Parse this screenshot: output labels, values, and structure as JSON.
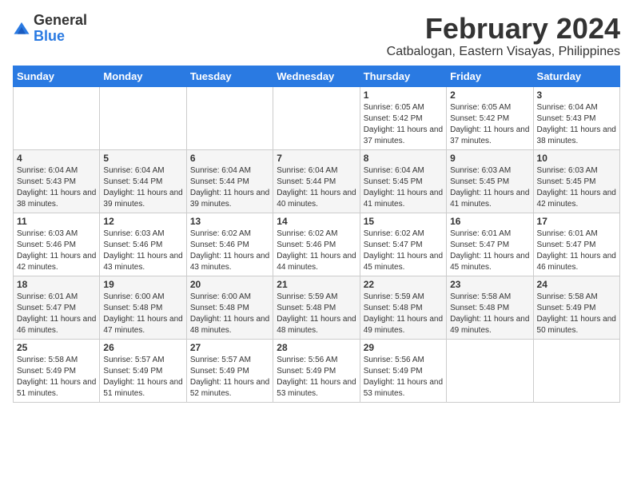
{
  "header": {
    "logo_general": "General",
    "logo_blue": "Blue",
    "main_title": "February 2024",
    "subtitle": "Catbalogan, Eastern Visayas, Philippines"
  },
  "calendar": {
    "days_of_week": [
      "Sunday",
      "Monday",
      "Tuesday",
      "Wednesday",
      "Thursday",
      "Friday",
      "Saturday"
    ],
    "weeks": [
      [
        {
          "day": "",
          "info": ""
        },
        {
          "day": "",
          "info": ""
        },
        {
          "day": "",
          "info": ""
        },
        {
          "day": "",
          "info": ""
        },
        {
          "day": "1",
          "info": "Sunrise: 6:05 AM\nSunset: 5:42 PM\nDaylight: 11 hours and 37 minutes."
        },
        {
          "day": "2",
          "info": "Sunrise: 6:05 AM\nSunset: 5:42 PM\nDaylight: 11 hours and 37 minutes."
        },
        {
          "day": "3",
          "info": "Sunrise: 6:04 AM\nSunset: 5:43 PM\nDaylight: 11 hours and 38 minutes."
        }
      ],
      [
        {
          "day": "4",
          "info": "Sunrise: 6:04 AM\nSunset: 5:43 PM\nDaylight: 11 hours and 38 minutes."
        },
        {
          "day": "5",
          "info": "Sunrise: 6:04 AM\nSunset: 5:44 PM\nDaylight: 11 hours and 39 minutes."
        },
        {
          "day": "6",
          "info": "Sunrise: 6:04 AM\nSunset: 5:44 PM\nDaylight: 11 hours and 39 minutes."
        },
        {
          "day": "7",
          "info": "Sunrise: 6:04 AM\nSunset: 5:44 PM\nDaylight: 11 hours and 40 minutes."
        },
        {
          "day": "8",
          "info": "Sunrise: 6:04 AM\nSunset: 5:45 PM\nDaylight: 11 hours and 41 minutes."
        },
        {
          "day": "9",
          "info": "Sunrise: 6:03 AM\nSunset: 5:45 PM\nDaylight: 11 hours and 41 minutes."
        },
        {
          "day": "10",
          "info": "Sunrise: 6:03 AM\nSunset: 5:45 PM\nDaylight: 11 hours and 42 minutes."
        }
      ],
      [
        {
          "day": "11",
          "info": "Sunrise: 6:03 AM\nSunset: 5:46 PM\nDaylight: 11 hours and 42 minutes."
        },
        {
          "day": "12",
          "info": "Sunrise: 6:03 AM\nSunset: 5:46 PM\nDaylight: 11 hours and 43 minutes."
        },
        {
          "day": "13",
          "info": "Sunrise: 6:02 AM\nSunset: 5:46 PM\nDaylight: 11 hours and 43 minutes."
        },
        {
          "day": "14",
          "info": "Sunrise: 6:02 AM\nSunset: 5:46 PM\nDaylight: 11 hours and 44 minutes."
        },
        {
          "day": "15",
          "info": "Sunrise: 6:02 AM\nSunset: 5:47 PM\nDaylight: 11 hours and 45 minutes."
        },
        {
          "day": "16",
          "info": "Sunrise: 6:01 AM\nSunset: 5:47 PM\nDaylight: 11 hours and 45 minutes."
        },
        {
          "day": "17",
          "info": "Sunrise: 6:01 AM\nSunset: 5:47 PM\nDaylight: 11 hours and 46 minutes."
        }
      ],
      [
        {
          "day": "18",
          "info": "Sunrise: 6:01 AM\nSunset: 5:47 PM\nDaylight: 11 hours and 46 minutes."
        },
        {
          "day": "19",
          "info": "Sunrise: 6:00 AM\nSunset: 5:48 PM\nDaylight: 11 hours and 47 minutes."
        },
        {
          "day": "20",
          "info": "Sunrise: 6:00 AM\nSunset: 5:48 PM\nDaylight: 11 hours and 48 minutes."
        },
        {
          "day": "21",
          "info": "Sunrise: 5:59 AM\nSunset: 5:48 PM\nDaylight: 11 hours and 48 minutes."
        },
        {
          "day": "22",
          "info": "Sunrise: 5:59 AM\nSunset: 5:48 PM\nDaylight: 11 hours and 49 minutes."
        },
        {
          "day": "23",
          "info": "Sunrise: 5:58 AM\nSunset: 5:48 PM\nDaylight: 11 hours and 49 minutes."
        },
        {
          "day": "24",
          "info": "Sunrise: 5:58 AM\nSunset: 5:49 PM\nDaylight: 11 hours and 50 minutes."
        }
      ],
      [
        {
          "day": "25",
          "info": "Sunrise: 5:58 AM\nSunset: 5:49 PM\nDaylight: 11 hours and 51 minutes."
        },
        {
          "day": "26",
          "info": "Sunrise: 5:57 AM\nSunset: 5:49 PM\nDaylight: 11 hours and 51 minutes."
        },
        {
          "day": "27",
          "info": "Sunrise: 5:57 AM\nSunset: 5:49 PM\nDaylight: 11 hours and 52 minutes."
        },
        {
          "day": "28",
          "info": "Sunrise: 5:56 AM\nSunset: 5:49 PM\nDaylight: 11 hours and 53 minutes."
        },
        {
          "day": "29",
          "info": "Sunrise: 5:56 AM\nSunset: 5:49 PM\nDaylight: 11 hours and 53 minutes."
        },
        {
          "day": "",
          "info": ""
        },
        {
          "day": "",
          "info": ""
        }
      ]
    ]
  }
}
